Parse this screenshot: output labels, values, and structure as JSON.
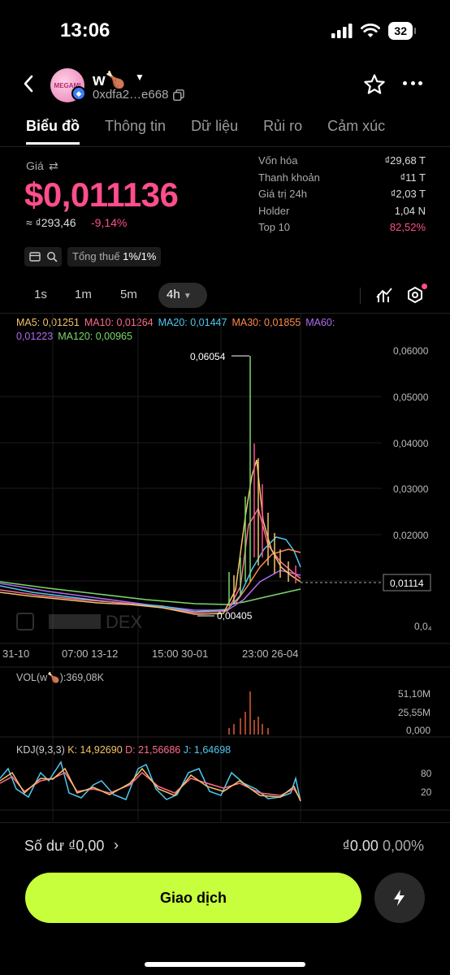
{
  "status_bar": {
    "time": "13:06",
    "battery": "32"
  },
  "header": {
    "avatar_text": "MEGAMI",
    "token_name": "w🍗",
    "address": "0xdfa2…e668"
  },
  "tabs": [
    "Biểu đồ",
    "Thông tin",
    "Dữ liệu",
    "Rủi ro",
    "Cảm xúc"
  ],
  "price": {
    "label": "Giá",
    "value": "$0,011136",
    "local_value": "≈ ₫293,46",
    "change": "-9,14%",
    "tax_label": "Tổng thuế",
    "tax_value": "1%/1%"
  },
  "stats": [
    {
      "label": "Vốn hóa",
      "value": "₫29,68 T"
    },
    {
      "label": "Thanh khoản",
      "value": "₫11 T"
    },
    {
      "label": "Giá trị 24h",
      "value": "₫2,03 T"
    },
    {
      "label": "Holder",
      "value": "1,04 N"
    },
    {
      "label": "Top 10",
      "value": "82,52%"
    }
  ],
  "intervals": [
    "1s",
    "1m",
    "5m",
    "4h"
  ],
  "ma_legend": {
    "ma5": "MA5: 0,01251",
    "ma10": "MA10: 0,01264",
    "ma20": "MA20: 0,01447",
    "ma30": "MA30: 0,01855",
    "ma60": "MA60: 0,01223",
    "ma120": "MA120: 0,00965"
  },
  "colors": {
    "ma5": "#f5c26b",
    "ma10": "#ff6b8a",
    "ma20": "#4fc8f0",
    "ma30": "#ff8a4c",
    "ma60": "#b06cf0",
    "ma120": "#7bd86a",
    "price_pink": "#ff4d8d",
    "trade_button": "#c7ff3c"
  },
  "chart_data": {
    "type": "line",
    "y_ticks": [
      "0,06000",
      "0,05000",
      "0,04000",
      "0,03000",
      "0,02000",
      "0,0₄"
    ],
    "x_ticks": [
      "31-10",
      "07:00 13-12",
      "15:00 30-01",
      "23:00 26-04"
    ],
    "high_label": "0,06054",
    "low_label": "0,00405",
    "current_price_label": "0,01114",
    "close_price": [
      0.0082,
      0.0078,
      0.0072,
      0.0066,
      0.006,
      0.0055,
      0.0052,
      0.005,
      0.0046,
      0.0044,
      0.0042,
      0.0041,
      0.0045,
      0.009,
      0.022,
      0.0605,
      0.038,
      0.024,
      0.016,
      0.013,
      0.0118,
      0.0111
    ],
    "watermark": "DEX"
  },
  "volume": {
    "legend": "VOL(w🍗):369,08K",
    "ticks": [
      "51,10M",
      "25,55M",
      "0,000"
    ]
  },
  "kdj": {
    "prefix": "KDJ(9,3,3)",
    "k": "K: 14,92690",
    "d": "D: 21,56686",
    "j": "J: 1,64698",
    "ticks": [
      "80",
      "20"
    ]
  },
  "balance": {
    "label": "Số dư ₫0,00",
    "value": "₫0.00",
    "percent": "0,00%"
  },
  "trade_button": "Giao dịch"
}
